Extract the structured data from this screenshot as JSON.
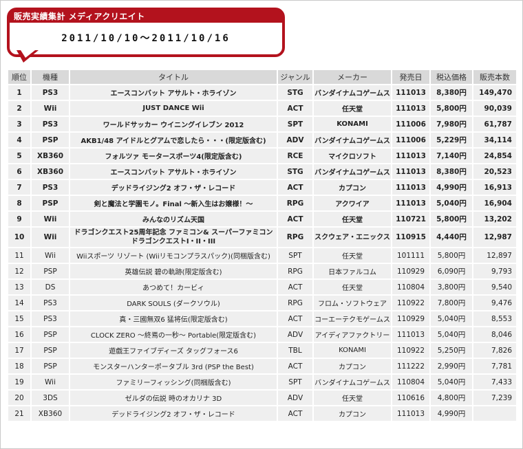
{
  "header": {
    "title": "販売実績集計 メディアクリエイト",
    "period": "2011/10/10～2011/10/16"
  },
  "columns": [
    "順位",
    "機種",
    "タイトル",
    "ジャンル",
    "メーカー",
    "発売日",
    "税込価格",
    "販売本数"
  ],
  "rows": [
    {
      "rank": "1",
      "platform": "PS3",
      "title": "エースコンバット アサルト・ホライゾン",
      "genre": "STG",
      "maker": "バンダイナムコゲームス",
      "release": "111013",
      "price": "8,380円",
      "sales": "149,470",
      "bold": true
    },
    {
      "rank": "2",
      "platform": "Wii",
      "title": "JUST DANCE Wii",
      "genre": "ACT",
      "maker": "任天堂",
      "release": "111013",
      "price": "5,800円",
      "sales": "90,039",
      "bold": true
    },
    {
      "rank": "3",
      "platform": "PS3",
      "title": "ワールドサッカー ウイニングイレブン 2012",
      "genre": "SPT",
      "maker": "KONAMI",
      "release": "111006",
      "price": "7,980円",
      "sales": "61,787",
      "bold": true
    },
    {
      "rank": "4",
      "platform": "PSP",
      "title": "AKB1/48 アイドルとグアムで恋したら・・・(限定版含む)",
      "genre": "ADV",
      "maker": "バンダイナムコゲームス",
      "release": "111006",
      "price": "5,229円",
      "sales": "34,114",
      "bold": true
    },
    {
      "rank": "5",
      "platform": "XB360",
      "title": "フォルツァ モータースポーツ4(限定版含む)",
      "genre": "RCE",
      "maker": "マイクロソフト",
      "release": "111013",
      "price": "7,140円",
      "sales": "24,854",
      "bold": true
    },
    {
      "rank": "6",
      "platform": "XB360",
      "title": "エースコンバット アサルト・ホライゾン",
      "genre": "STG",
      "maker": "バンダイナムコゲームス",
      "release": "111013",
      "price": "8,380円",
      "sales": "20,523",
      "bold": true
    },
    {
      "rank": "7",
      "platform": "PS3",
      "title": "デッドライジング2 オフ・ザ・レコード",
      "genre": "ACT",
      "maker": "カプコン",
      "release": "111013",
      "price": "4,990円",
      "sales": "16,913",
      "bold": true
    },
    {
      "rank": "8",
      "platform": "PSP",
      "title": "剣と魔法と学園モノ。Final ～新入生はお嬢様！～",
      "genre": "RPG",
      "maker": "アクワイア",
      "release": "111013",
      "price": "5,040円",
      "sales": "16,904",
      "bold": true
    },
    {
      "rank": "9",
      "platform": "Wii",
      "title": "みんなのリズム天国",
      "genre": "ACT",
      "maker": "任天堂",
      "release": "110721",
      "price": "5,800円",
      "sales": "13,202",
      "bold": true
    },
    {
      "rank": "10",
      "platform": "Wii",
      "title": "ドラゴンクエスト25周年記念 ファミコン& スーパーファミコン ドラゴンクエストI・II・III",
      "genre": "RPG",
      "maker": "スクウェア・エニックス",
      "release": "110915",
      "price": "4,440円",
      "sales": "12,987",
      "bold": true,
      "tall": true
    },
    {
      "rank": "11",
      "platform": "Wii",
      "title": "Wiiスポーツ リゾート (Wiiリモコンプラスパック)(同梱版含む)",
      "genre": "SPT",
      "maker": "任天堂",
      "release": "101111",
      "price": "5,800円",
      "sales": "12,897"
    },
    {
      "rank": "12",
      "platform": "PSP",
      "title": "英雄伝説 碧の軌跡(限定版含む)",
      "genre": "RPG",
      "maker": "日本ファルコム",
      "release": "110929",
      "price": "6,090円",
      "sales": "9,793"
    },
    {
      "rank": "13",
      "platform": "DS",
      "title": "あつめて！カービィ",
      "genre": "ACT",
      "maker": "任天堂",
      "release": "110804",
      "price": "3,800円",
      "sales": "9,540"
    },
    {
      "rank": "14",
      "platform": "PS3",
      "title": "DARK SOULS (ダークソウル)",
      "genre": "RPG",
      "maker": "フロム・ソフトウェア",
      "release": "110922",
      "price": "7,800円",
      "sales": "9,476"
    },
    {
      "rank": "15",
      "platform": "PS3",
      "title": "真・三國無双6 猛将伝(限定版含む)",
      "genre": "ACT",
      "maker": "コーエーテクモゲームス",
      "release": "110929",
      "price": "5,040円",
      "sales": "8,553"
    },
    {
      "rank": "16",
      "platform": "PSP",
      "title": "CLOCK ZERO ～終焉の一秒～ Portable(限定版含む)",
      "genre": "ADV",
      "maker": "アイディアファクトリー",
      "release": "111013",
      "price": "5,040円",
      "sales": "8,046"
    },
    {
      "rank": "17",
      "platform": "PSP",
      "title": "遊戯王ファイブディーズ タッグフォース6",
      "genre": "TBL",
      "maker": "KONAMI",
      "release": "110922",
      "price": "5,250円",
      "sales": "7,826"
    },
    {
      "rank": "18",
      "platform": "PSP",
      "title": "モンスターハンターポータブル 3rd (PSP the Best)",
      "genre": "ACT",
      "maker": "カプコン",
      "release": "111222",
      "price": "2,990円",
      "sales": "7,781"
    },
    {
      "rank": "19",
      "platform": "Wii",
      "title": "ファミリーフィッシング(同梱版含む)",
      "genre": "SPT",
      "maker": "バンダイナムコゲームス",
      "release": "110804",
      "price": "5,040円",
      "sales": "7,433"
    },
    {
      "rank": "20",
      "platform": "3DS",
      "title": "ゼルダの伝説 時のオカリナ 3D",
      "genre": "ADV",
      "maker": "任天堂",
      "release": "110616",
      "price": "4,800円",
      "sales": "7,239"
    },
    {
      "rank": "21",
      "platform": "XB360",
      "title": "デッドライジング2 オフ・ザ・レコード",
      "genre": "ACT",
      "maker": "カプコン",
      "release": "111013",
      "price": "4,990円",
      "sales": ""
    }
  ]
}
